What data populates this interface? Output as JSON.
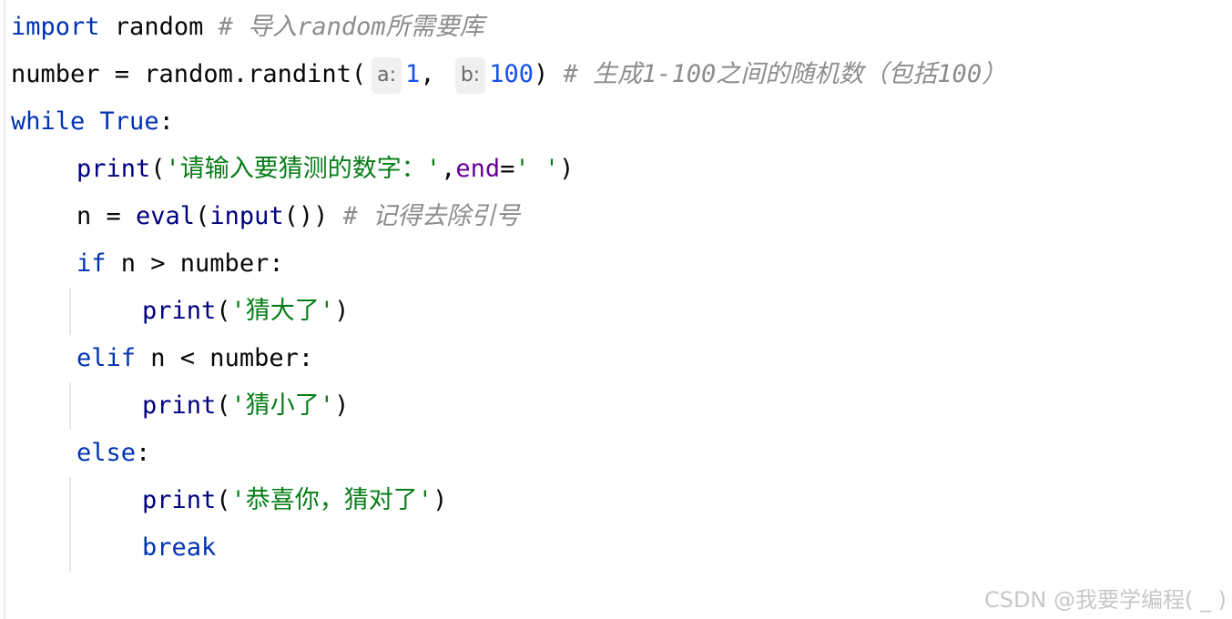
{
  "code": {
    "line1": {
      "kw": "import",
      "mod": " random ",
      "comment": "# 导入random所需要库"
    },
    "line2": {
      "lhs": "number = random.randint(",
      "hint_a": "a:",
      "val_a": "1",
      "sep": ", ",
      "hint_b": "b:",
      "val_b": "100",
      "close": ") ",
      "comment": "# 生成1-100之间的随机数（包括100）"
    },
    "line3": {
      "kw1": "while",
      "sp": " ",
      "kw2": "True",
      "colon": ":"
    },
    "line4": {
      "fn": "print",
      "open": "(",
      "str1": "'请输入要猜测的数字：'",
      "comma": ",",
      "kwarg": "end",
      "eq": "=",
      "str2": "' '",
      "close": ")"
    },
    "line5": {
      "lhs": "n = ",
      "fn1": "eval",
      "open1": "(",
      "fn2": "input",
      "rest": "()) ",
      "comment": "# 记得去除引号"
    },
    "line6": {
      "kw": "if",
      "rest": " n > number:"
    },
    "line7": {
      "fn": "print",
      "open": "(",
      "str": "'猜大了'",
      "close": ")"
    },
    "line8": {
      "kw": "elif",
      "rest": " n < number:"
    },
    "line9": {
      "fn": "print",
      "open": "(",
      "str": "'猜小了'",
      "close": ")"
    },
    "line10": {
      "kw": "else",
      "rest": ":"
    },
    "line11": {
      "fn": "print",
      "open": "(",
      "str": "'恭喜你，猜对了'",
      "close": ")"
    },
    "line12": {
      "kw": "break"
    }
  },
  "watermark": "CSDN @我要学编程( _ )"
}
